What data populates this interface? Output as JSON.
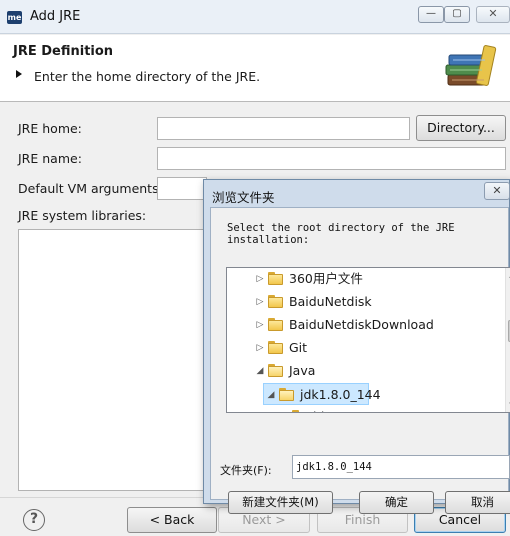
{
  "window": {
    "icon_text": "me",
    "title": "Add JRE",
    "controls": {
      "minimize": "—",
      "maximize": "▢",
      "close": "✕"
    }
  },
  "banner": {
    "title": "JRE Definition",
    "message": "Enter the home directory of the JRE.",
    "icon": "books-icon"
  },
  "form": {
    "jre_home_label": "JRE home:",
    "jre_home_value": "",
    "directory_button": "Directory...",
    "jre_name_label": "JRE name:",
    "jre_name_value": "",
    "vm_args_label": "Default VM arguments:",
    "libraries_label": "JRE system libraries:"
  },
  "buttons": {
    "help": "?",
    "back": "< Back",
    "next": "Next >",
    "finish": "Finish",
    "cancel": "Cancel"
  },
  "browse_dialog": {
    "title": "浏览文件夹",
    "close": "✕",
    "description": "Select the root directory of the JRE\ninstallation:",
    "tree": [
      {
        "label": "360用户文件",
        "expander": "▷",
        "state": "collapsed"
      },
      {
        "label": "BaiduNetdisk",
        "expander": "▷",
        "state": "collapsed"
      },
      {
        "label": "BaiduNetdiskDownload",
        "expander": "▷",
        "state": "collapsed"
      },
      {
        "label": "Git",
        "expander": "▷",
        "state": "collapsed"
      },
      {
        "label": "Java",
        "expander": "◢",
        "state": "expanded"
      },
      {
        "label": "jdk1.8.0_144",
        "expander": "◢",
        "state": "expanded",
        "selected": true
      },
      {
        "label": "bin",
        "expander": "",
        "state": "leaf"
      }
    ],
    "folder_label": "文件夹(F):",
    "folder_value": "jdk1.8.0_144",
    "new_folder_button": "新建文件夹(M)",
    "ok_button": "确定",
    "cancel_button": "取消"
  },
  "colors": {
    "selection": "#cce8ff",
    "dialog_frame": "#cfdceb",
    "folder": "#f2c64b"
  }
}
